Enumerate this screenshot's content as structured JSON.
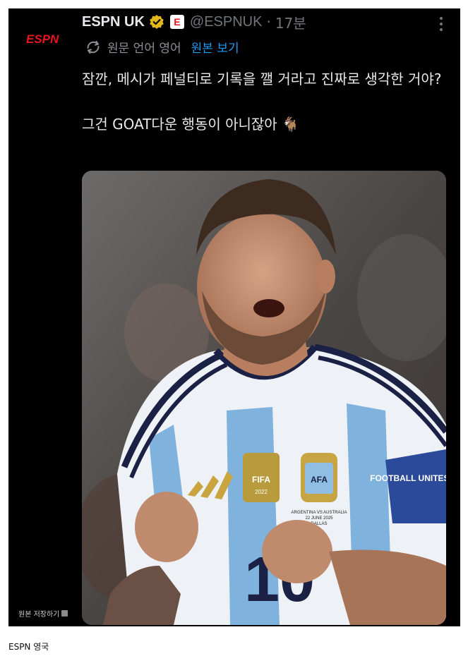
{
  "tweet": {
    "logo_text": "ESPN",
    "display_name": "ESPN UK",
    "badge_letter": "E",
    "handle": "@ESPNUK",
    "separator": "·",
    "time": "17분",
    "translation": {
      "source_label": "원문 언어 영어",
      "show_original_link": "원본 보기"
    },
    "text_line1": "잠깐, 메시가 페널티로 기록을 깰 거라고 진짜로 생각한 거야?",
    "text_line2": "그건 GOAT다운 행동이 아니잖아 🐐",
    "media": {
      "icon": "photo-player-celebrating",
      "jersey_badge_text": "FIFA",
      "jersey_badge_year": "2022",
      "jersey_logo_text": "AFA",
      "match_text": "ARGENTINA VS AUSTRALIA",
      "match_date": "22 JUNE 2025",
      "match_city": "DALLAS",
      "shirt_number": "10",
      "armband_text": "FOOTBALL UNITES the"
    },
    "save_original_label": "원본 저장하기"
  },
  "caption": "ESPN 영국",
  "colors": {
    "background": "#000000",
    "text": "#e7e9ea",
    "muted": "#71767b",
    "link": "#1d9bf0",
    "brand": "#e8141f",
    "verified": "#e2b719"
  }
}
